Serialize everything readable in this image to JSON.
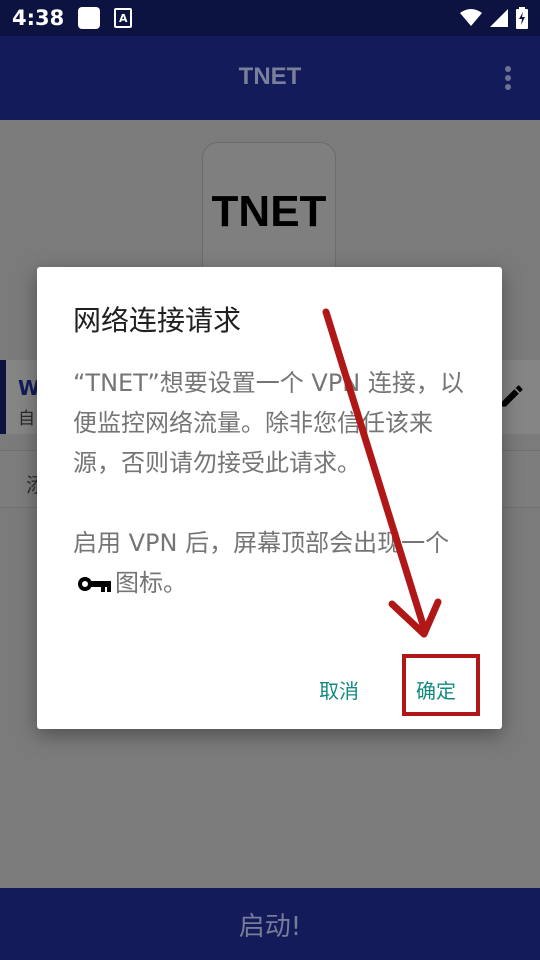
{
  "status_bar": {
    "time": "4:38",
    "notif_a": "A"
  },
  "app_bar": {
    "title": "TNET"
  },
  "content": {
    "logo_text": "TNET",
    "server_name": "W",
    "server_sub": "自",
    "add_label": "添"
  },
  "dialog": {
    "title": "网络连接请求",
    "body_line1": "“TNET”想要设置一个 VPN 连接，以便监控网络流量。除非您信任该来源，否则请勿接受此请求。",
    "body_line2_before": "启用 VPN 后，屏幕顶部会出现一个",
    "body_line2_after": "图标。",
    "cancel": "取消",
    "ok": "确定"
  },
  "start_button": {
    "label": "启动!"
  },
  "colors": {
    "status_bar": "#0d1340",
    "app_bar": "#131b5a",
    "dialog_button": "#138a80",
    "annotation": "#b01818"
  }
}
